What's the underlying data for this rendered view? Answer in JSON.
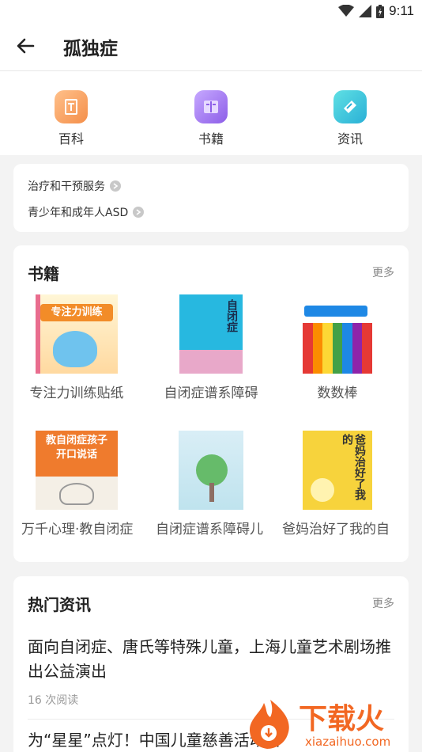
{
  "status": {
    "time": "9:11",
    "icons": [
      "wifi-icon",
      "signal-icon",
      "battery-icon"
    ]
  },
  "header": {
    "title": "孤独症",
    "back_icon": "arrow-left-icon"
  },
  "quick_nav": [
    {
      "label": "百科",
      "icon": "encyclopedia-icon",
      "color": "#f5a35c"
    },
    {
      "label": "书籍",
      "icon": "book-icon",
      "color": "#a57bf1"
    },
    {
      "label": "资讯",
      "icon": "news-icon",
      "color": "#3cc8d6"
    }
  ],
  "tags": [
    {
      "label": "治疗和干预服务"
    },
    {
      "label": "青少年和成年人ASD"
    }
  ],
  "books": {
    "title": "书籍",
    "more": "更多",
    "items": [
      {
        "name": "专注力训练贴纸",
        "cover_text": "专注力训练"
      },
      {
        "name": "自闭症谱系障碍",
        "cover_text": "自闭症"
      },
      {
        "name": "数数棒",
        "cover_text": ""
      },
      {
        "name": "万千心理·教自闭症孩子开口说话",
        "cover_text": "教自闭症孩子开口说话"
      },
      {
        "name": "自闭症谱系障碍儿童学习风格简介",
        "cover_text": ""
      },
      {
        "name": "爸妈治好了我的自闭症",
        "cover_text": "爸妈治好了我的"
      }
    ]
  },
  "news": {
    "title": "热门资讯",
    "more": "更多",
    "items": [
      {
        "headline": "面向自闭症、唐氏等特殊儿童，上海儿童艺术剧场推出公益演出",
        "reads": "16 次阅读"
      },
      {
        "headline": "为“星星”点灯！中国儿童慈善活动日",
        "reads": ""
      }
    ]
  },
  "watermark": {
    "brand": "下载火",
    "url": "xiazaihuo.com"
  }
}
